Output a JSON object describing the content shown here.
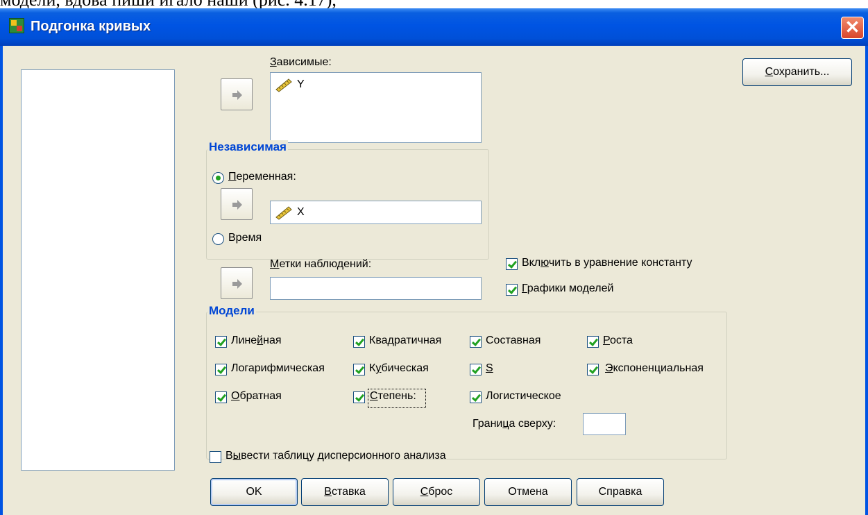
{
  "background_text": "модели, вдова пиши игало наши (рис. 4.17),",
  "window": {
    "title": "Подгонка кривых",
    "close_label": "✕"
  },
  "dependent": {
    "label": "Зависимые:",
    "items": [
      {
        "name": "Y",
        "icon": "ruler-icon"
      }
    ]
  },
  "independent": {
    "group_title": "Независимая",
    "variable_label": "Переменная:",
    "variable_selected": true,
    "variable_value": "X",
    "time_label": "Время",
    "time_selected": false
  },
  "case_labels": {
    "label": "Метки наблюдений:",
    "value": ""
  },
  "options": {
    "include_constant": {
      "label": "Включить в уравнение константу",
      "checked": true
    },
    "plot_models": {
      "label": "Графики моделей",
      "checked": true
    }
  },
  "models": {
    "group_title": "Модели",
    "items": [
      {
        "label": "Линейная",
        "checked": true
      },
      {
        "label": "Квадратичная",
        "checked": true
      },
      {
        "label": "Составная",
        "checked": true
      },
      {
        "label": "Роста",
        "checked": true
      },
      {
        "label": "Логарифмическая",
        "checked": true
      },
      {
        "label": "Кубическая",
        "checked": true
      },
      {
        "label": "S",
        "checked": true
      },
      {
        "label": "Экспоненциальная",
        "checked": true
      },
      {
        "label": "Обратная",
        "checked": true
      },
      {
        "label": "Степень:",
        "checked": true
      },
      {
        "label": "Логистическое",
        "checked": true
      }
    ],
    "upper_bound_label": "Граница сверху:",
    "upper_bound_value": ""
  },
  "anova": {
    "label": "Вывести таблицу дисперсионного анализа",
    "checked": false
  },
  "buttons": {
    "save": "Сохранить...",
    "ok": "OK",
    "paste": "Вставка",
    "reset": "Сброс",
    "cancel": "Отмена",
    "help": "Справка"
  },
  "colors": {
    "title_bar": "#0054e3",
    "group_title": "#0046d5",
    "dialog_bg": "#ece9d8",
    "check_mark": "#21a121",
    "close_button": "#d9452b"
  }
}
